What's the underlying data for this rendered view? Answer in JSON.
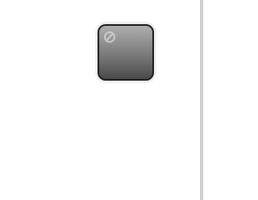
{
  "tile": {
    "icon": "prohibited-icon",
    "colors": {
      "top": "#aeaeae",
      "mid": "#7a7a7a",
      "bottom": "#4a4a4a",
      "border": "#1c1c1c",
      "icon": "#c9c9c9"
    }
  },
  "scrollbar": {
    "color": "#cfcfcf"
  }
}
